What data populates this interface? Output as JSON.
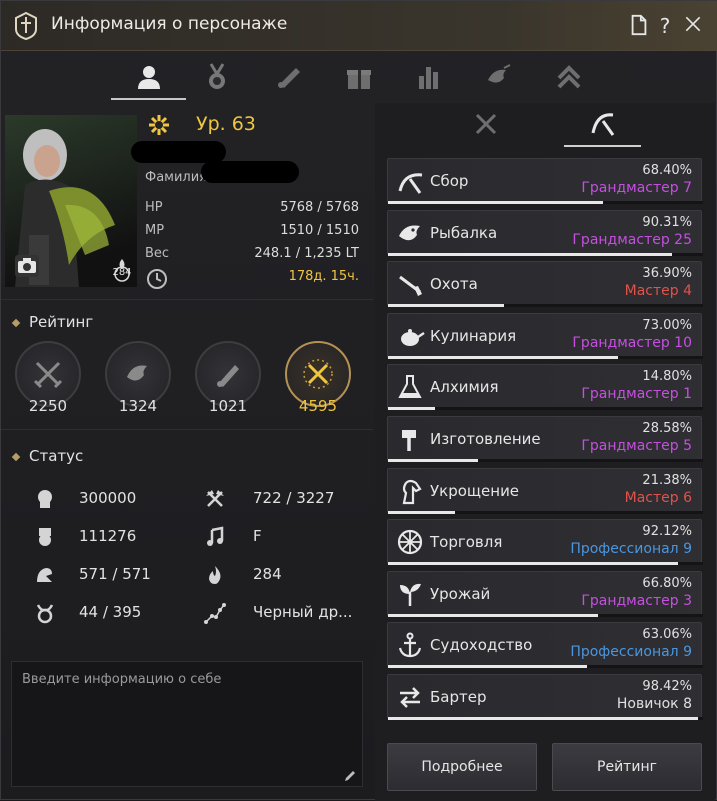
{
  "window": {
    "title": "Информация о персонаже"
  },
  "profile": {
    "level": "Ур. 63",
    "family_label": "Фамилия",
    "stats": [
      {
        "label": "HP",
        "value": "5768 / 5768"
      },
      {
        "label": "MP",
        "value": "1510 / 1510"
      },
      {
        "label": "Вес",
        "value": "248.1 / 1,235 LT"
      }
    ],
    "playtime": "178д. 15ч.",
    "badge_number": "284"
  },
  "rating": {
    "heading": "Рейтинг",
    "items": [
      {
        "value": "2250",
        "icon": "crossed-swords-icon"
      },
      {
        "value": "1324",
        "icon": "fish-icon"
      },
      {
        "value": "1021",
        "icon": "scroll-icon"
      },
      {
        "value": "4595",
        "icon": "gold-crossed-swords-icon",
        "highlight": true
      }
    ]
  },
  "status": {
    "heading": "Статус",
    "left": [
      {
        "icon": "head-icon",
        "value": "300000"
      },
      {
        "icon": "badge-icon",
        "value": "111276"
      },
      {
        "icon": "arm-icon",
        "value": "571 / 571"
      },
      {
        "icon": "taurus-icon",
        "value": "44 / 395"
      }
    ],
    "right": [
      {
        "icon": "axe-icon",
        "value": "722 / 3227"
      },
      {
        "icon": "music-note-icon",
        "value": "F"
      },
      {
        "icon": "fire-icon",
        "value": "284"
      },
      {
        "icon": "constellation-icon",
        "value": "Черный др..."
      }
    ]
  },
  "about": {
    "placeholder": "Введите информацию о себе"
  },
  "skills": [
    {
      "name": "Сбор",
      "percent": "68.40%",
      "rank": "Грандмастер 7",
      "rank_color": "#c64fe0",
      "progress": 0.684,
      "icon": "sickle-icon"
    },
    {
      "name": "Рыбалка",
      "percent": "90.31%",
      "rank": "Грандмастер 25",
      "rank_color": "#c64fe0",
      "progress": 0.9031,
      "icon": "fish-icon"
    },
    {
      "name": "Охота",
      "percent": "36.90%",
      "rank": "Мастер 4",
      "rank_color": "#e0524a",
      "progress": 0.369,
      "icon": "rifle-icon"
    },
    {
      "name": "Кулинария",
      "percent": "73.00%",
      "rank": "Грандмастер 10",
      "rank_color": "#c64fe0",
      "progress": 0.73,
      "icon": "teapot-icon"
    },
    {
      "name": "Алхимия",
      "percent": "14.80%",
      "rank": "Грандмастер 1",
      "rank_color": "#c64fe0",
      "progress": 0.148,
      "icon": "flask-icon"
    },
    {
      "name": "Изготовление",
      "percent": "28.58%",
      "rank": "Грандмастер 5",
      "rank_color": "#c64fe0",
      "progress": 0.2858,
      "icon": "hammer-icon"
    },
    {
      "name": "Укрощение",
      "percent": "21.38%",
      "rank": "Мастер 6",
      "rank_color": "#e0524a",
      "progress": 0.2138,
      "icon": "horse-icon"
    },
    {
      "name": "Торговля",
      "percent": "92.12%",
      "rank": "Профессионал 9",
      "rank_color": "#4a97e0",
      "progress": 0.9212,
      "icon": "wheel-icon"
    },
    {
      "name": "Урожай",
      "percent": "66.80%",
      "rank": "Грандмастер 3",
      "rank_color": "#c64fe0",
      "progress": 0.668,
      "icon": "sprout-icon"
    },
    {
      "name": "Судоходство",
      "percent": "63.06%",
      "rank": "Профессионал 9",
      "rank_color": "#4a97e0",
      "progress": 0.6306,
      "icon": "anchor-icon"
    },
    {
      "name": "Бартер",
      "percent": "98.42%",
      "rank": "Новичок 8",
      "rank_color": "#e0e0e0",
      "progress": 0.9842,
      "icon": "exchange-icon"
    }
  ],
  "buttons": {
    "details": "Подробнее",
    "rating": "Рейтинг"
  }
}
